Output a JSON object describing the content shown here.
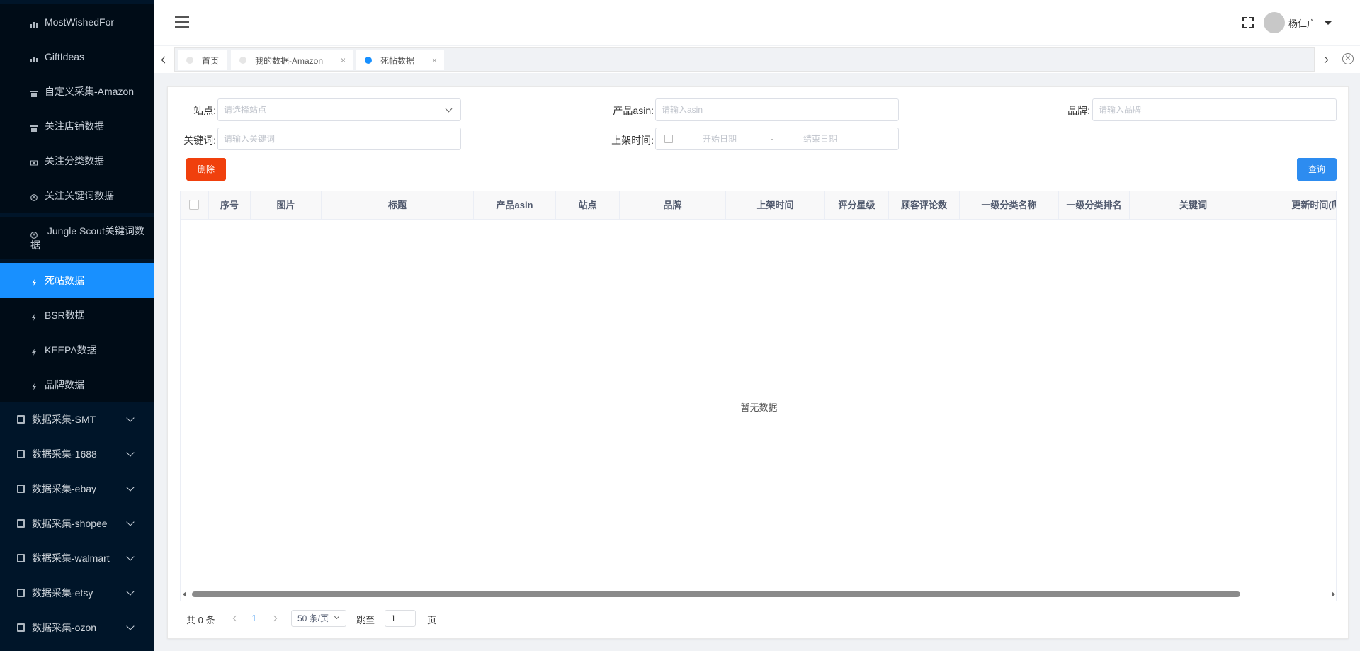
{
  "sidebar": {
    "sub_items": [
      {
        "label": "MostWishedFor"
      },
      {
        "label": "GiftIdeas"
      },
      {
        "label": "自定义采集-Amazon"
      },
      {
        "label": "关注店铺数据"
      },
      {
        "label": "关注分类数据"
      },
      {
        "label": "关注关键词数据"
      },
      {
        "label": "Jungle Scout关键词数据"
      },
      {
        "label": "死帖数据"
      },
      {
        "label": "BSR数据"
      },
      {
        "label": "KEEPA数据"
      },
      {
        "label": "品牌数据"
      }
    ],
    "main_items": [
      {
        "label": "数据采集-SMT"
      },
      {
        "label": "数据采集-1688"
      },
      {
        "label": "数据采集-ebay"
      },
      {
        "label": "数据采集-shopee"
      },
      {
        "label": "数据采集-walmart"
      },
      {
        "label": "数据采集-etsy"
      },
      {
        "label": "数据采集-ozon"
      }
    ],
    "active_color": "#1890ff",
    "bg_color": "#001529"
  },
  "header": {
    "username": "杨仁广"
  },
  "tabs": [
    {
      "label": "首页",
      "closable": false
    },
    {
      "label": "我的数据-Amazon",
      "closable": true,
      "close": "×"
    },
    {
      "label": "死帖数据",
      "closable": true,
      "active": true,
      "close": "×"
    }
  ],
  "filters": {
    "site_label": "站点:",
    "site_placeholder": "请选择站点",
    "asin_label": "产品asin:",
    "asin_placeholder": "请输入asin",
    "brand_label": "品牌:",
    "brand_placeholder": "请输入品牌",
    "keyword_label": "关键词:",
    "keyword_placeholder": "请输入关键词",
    "date_label": "上架时间:",
    "date_start_placeholder": "开始日期",
    "date_sep": "-",
    "date_end_placeholder": "结束日期"
  },
  "buttons": {
    "delete": "删除",
    "query": "查询",
    "delete_color": "#f0400d",
    "query_color": "#2d8cf0"
  },
  "table": {
    "columns": [
      "序号",
      "图片",
      "标题",
      "产品asin",
      "站点",
      "品牌",
      "上架时间",
      "评分星级",
      "顾客评论数",
      "一级分类名称",
      "一级分类排名",
      "关键词",
      "更新时间(爬取"
    ],
    "empty_text": "暂无数据"
  },
  "pagination": {
    "total_text": "共 0 条",
    "current_page": "1",
    "page_size": "50 条/页",
    "goto_label": "跳至",
    "goto_value": "1",
    "page_unit": "页"
  },
  "close_all_glyph": "✕"
}
